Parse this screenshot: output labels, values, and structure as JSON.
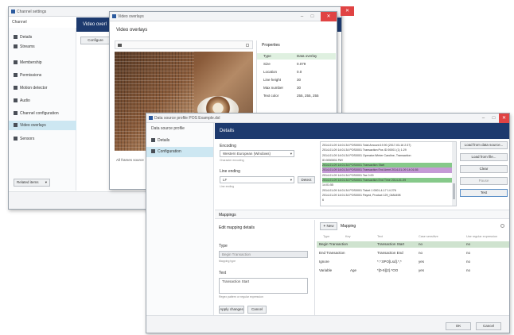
{
  "back_window": {
    "title": "Channel settings",
    "channel_label": "Channel",
    "header_text": "Video overl",
    "configure_btn": "Configure",
    "sidebar": [
      {
        "label": "Details",
        "icon": "pencil-icon"
      },
      {
        "label": "Streams",
        "icon": "stream-icon"
      },
      {
        "label": "Membership",
        "icon": "membership-icon"
      },
      {
        "label": "Permissions",
        "icon": "lock-icon"
      },
      {
        "label": "Motion detector",
        "icon": "motion-icon"
      },
      {
        "label": "Audio",
        "icon": "speaker-icon"
      },
      {
        "label": "Channel configuration",
        "icon": "config-icon"
      },
      {
        "label": "Video overlays",
        "icon": "overlay-icon"
      },
      {
        "label": "Sensors",
        "icon": "sensor-icon"
      }
    ],
    "related_items_btn": "Related items"
  },
  "overlay_window": {
    "title": "Video overlays",
    "header": "Video overlays",
    "properties_label": "Properties",
    "props": [
      {
        "name": "Type",
        "value": "Data overlay"
      },
      {
        "name": "Size",
        "value": "0.079"
      },
      {
        "name": "Location",
        "value": "0.0"
      },
      {
        "name": "Line height",
        "value": "30"
      },
      {
        "name": "Max number",
        "value": "30"
      },
      {
        "name": "Text color",
        "value": "255, 255, 255"
      }
    ],
    "footer_note": "All frames source"
  },
  "front_window": {
    "title": "Data source profile POS Example.dsl",
    "sidebar_header": "Data source profile",
    "sidebar": [
      {
        "label": "Details",
        "icon": "pencil-icon"
      },
      {
        "label": "Configuration",
        "icon": "config-icon"
      }
    ],
    "header": "Details",
    "encoding_label": "Encoding",
    "encoding_value": "Western European (Windows)",
    "encoding_hint": "Character encoding",
    "line_ending_label": "Line ending",
    "line_ending_value": "LF",
    "line_ending_hint": "Line ending",
    "detect_btn": "Detect",
    "log_lines": [
      "2014-01-09 14:01:34 POS0001 Total Amount:19.90 (2017-03-16 2:37)",
      "2014-01-09 14:01:34 POS0001 Transaction:Pos ID 00001 (1) 1:29",
      "2014-01-09 14:01:34 POS0001 Operator:Winter Caroline, Transaction",
      "ID:0000001 PAY",
      "2014-01-09 14:01:34 POS0001 Transaction Start",
      "2014-01-09 14:01:34 POS0001 Transaction End Amnt 2014-01-09 14:01:55",
      "2014-01-09 14:01:34 POS0001 Tax 0.00",
      "2014-01-09 14:01:34 POS0001 Transaction End Time 2014-01-09",
      "14:01:55",
      "2014-01-09 14:01:34 POS0001 Ticket 1 0001-4-17 14 276",
      "2014-01-09 14:01:34 POS0001 Payed, Product 129_0484498",
      "6"
    ],
    "actions": [
      "Load from data source...",
      "Load from file...",
      "Clear",
      "Pause",
      "Test"
    ],
    "mappings_label": "Mappings",
    "edit_mapping_label": "Edit mapping details",
    "new_btn": "New",
    "mapping_label": "Mapping",
    "type_label": "Type",
    "type_value": "Begin Transaction",
    "type_hint": "Mapping type",
    "text_label": "Text",
    "text_value": "Transaction Start",
    "text_hint": "Regex pattern or regular expression",
    "apply_btn": "Apply changes",
    "cancel_btn": "Cancel",
    "table_headers": [
      "Type",
      "Key",
      "Text",
      "Case sensitive",
      "Use regular expression"
    ],
    "table_rows": [
      {
        "type": "Begin Transaction",
        "key": "",
        "text": "Transaction Start",
        "case": "no",
        "regex": "no",
        "selected": true
      },
      {
        "type": "End Transaction",
        "key": "",
        "text": "Transaction End",
        "case": "no",
        "regex": "no",
        "selected": false
      },
      {
        "type": "Ignore",
        "key": "",
        "text": "*.*:0PO[Lsd].*,*",
        "case": "yes",
        "regex": "no",
        "selected": false
      },
      {
        "type": "Variable",
        "key": "Age",
        "text": "*[0-9]{2}.*OO",
        "case": "yes",
        "regex": "no",
        "selected": false
      }
    ],
    "ok_btn": "OK",
    "cancel_bottom_btn": "Cancel"
  },
  "colors": {
    "navy": "#1d3a6e",
    "selection": "#cfe3cf",
    "nav_selected": "#cde7f2",
    "close": "#e04343"
  }
}
